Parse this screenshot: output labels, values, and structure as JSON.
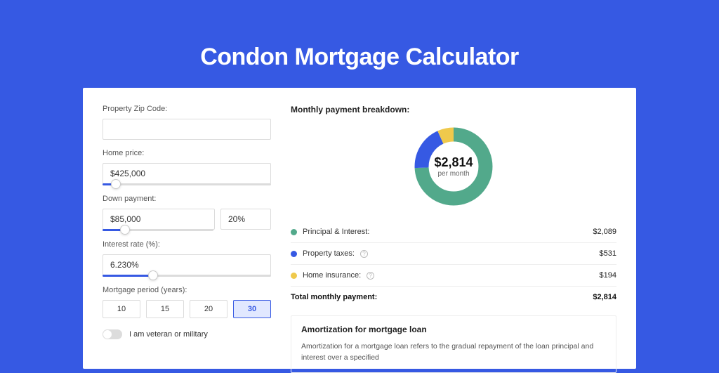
{
  "title": "Condon Mortgage Calculator",
  "form": {
    "zip_label": "Property Zip Code:",
    "zip_value": "",
    "home_price_label": "Home price:",
    "home_price_value": "$425,000",
    "home_price_slider_pct": 8,
    "down_payment_label": "Down payment:",
    "down_payment_amount": "$85,000",
    "down_payment_pct": "20%",
    "down_payment_slider_pct": 20,
    "interest_label": "Interest rate (%):",
    "interest_value": "6.230%",
    "interest_slider_pct": 30,
    "period_label": "Mortgage period (years):",
    "periods": [
      "10",
      "15",
      "20",
      "30"
    ],
    "period_active": "30",
    "veteran_label": "I am veteran or military"
  },
  "breakdown": {
    "title": "Monthly payment breakdown:",
    "total_display": "$2,814",
    "total_sub": "per month",
    "items": [
      {
        "name": "Principal & Interest:",
        "color": "green",
        "amount": "$2,089",
        "value": 2089,
        "help": false
      },
      {
        "name": "Property taxes:",
        "color": "blue",
        "amount": "$531",
        "value": 531,
        "help": true
      },
      {
        "name": "Home insurance:",
        "color": "yellow",
        "amount": "$194",
        "value": 194,
        "help": true
      }
    ],
    "total_label": "Total monthly payment:",
    "total_amount": "$2,814"
  },
  "chart_data": {
    "type": "pie",
    "title": "Monthly payment breakdown",
    "series": [
      {
        "name": "Principal & Interest",
        "value": 2089,
        "color": "#52a98b"
      },
      {
        "name": "Property taxes",
        "value": 531,
        "color": "#3659e3"
      },
      {
        "name": "Home insurance",
        "value": 194,
        "color": "#efc94c"
      }
    ],
    "center_label": "$2,814",
    "center_sub": "per month"
  },
  "amort": {
    "title": "Amortization for mortgage loan",
    "text": "Amortization for a mortgage loan refers to the gradual repayment of the loan principal and interest over a specified"
  }
}
